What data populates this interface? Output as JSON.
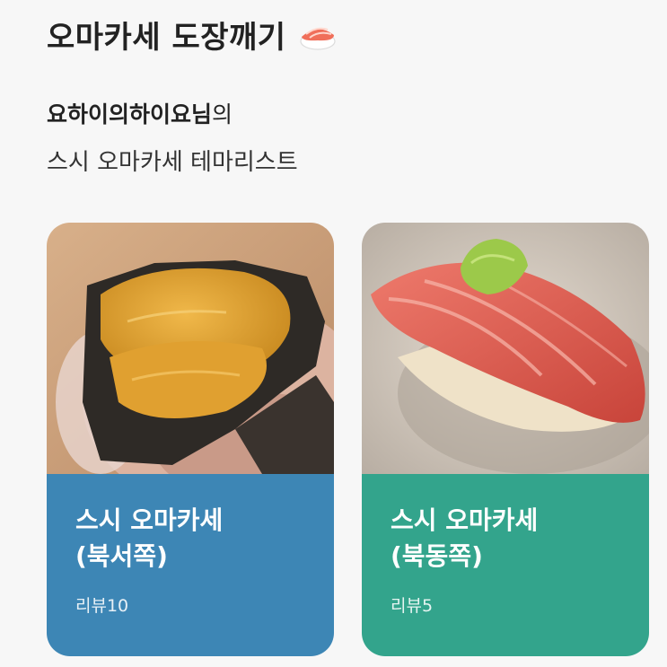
{
  "header": {
    "title": "오마카세 도장깨기",
    "emoji_icon": "sushi-icon",
    "nickname": "요하이의하이요님",
    "nickname_suffix": "의",
    "subtitle": "스시 오마카세 테마리스트"
  },
  "cards": [
    {
      "name_line1": "스시 오마카세",
      "name_line2": "(북서쪽)",
      "reviews": "리뷰10",
      "color": "#3d86b5",
      "image": "uni-handroll-photo"
    },
    {
      "name_line1": "스시 오마카세",
      "name_line2": "(북동쪽)",
      "reviews": "리뷰5",
      "color": "#33a48c",
      "image": "tuna-nigiri-photo"
    }
  ]
}
